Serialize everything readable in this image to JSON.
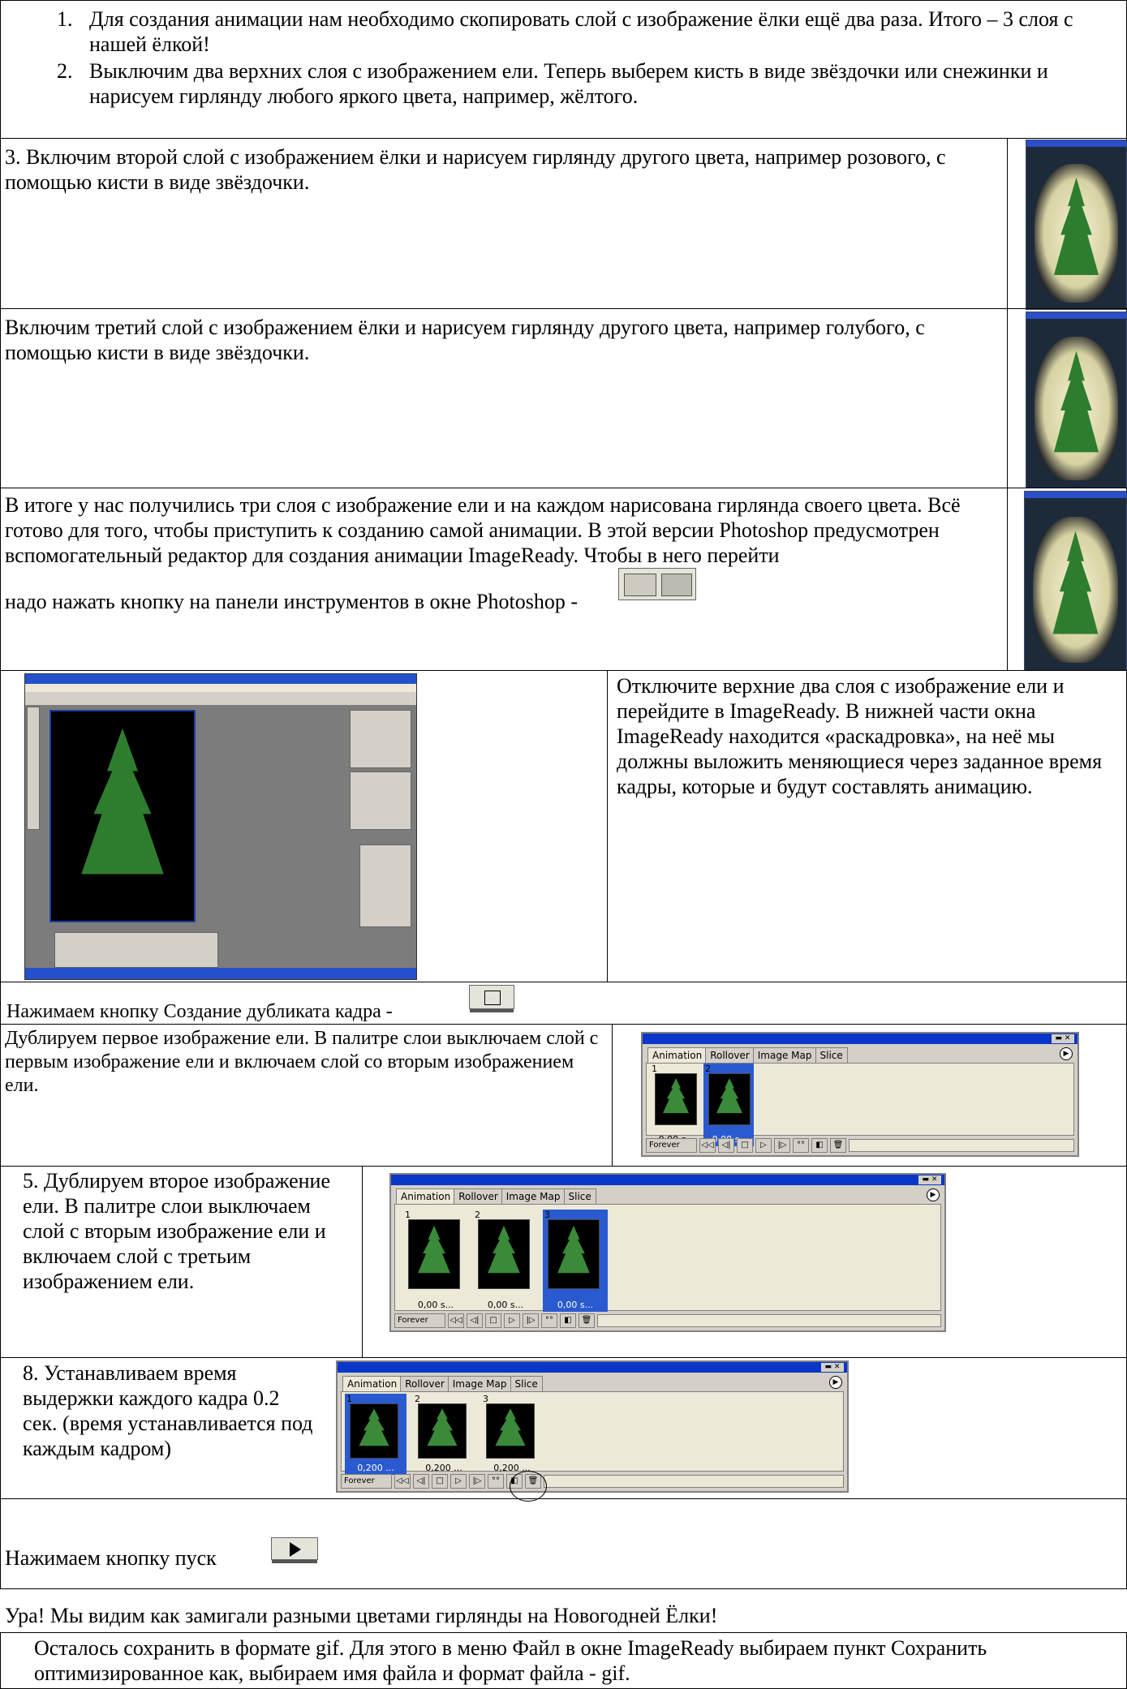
{
  "section1": {
    "items": [
      {
        "num": "1.",
        "text": "Для создания анимации нам необходимо скопировать слой с изображение ёлки ещё два раза. Итого – 3 слоя с нашей ёлкой!"
      },
      {
        "num": "2.",
        "text": "Выключим два верхних слоя с изображением ели. Теперь выберем кисть в виде звёздочки или снежинки и нарисуем гирлянду любого яркого цвета, например, жёлтого."
      }
    ]
  },
  "section2": {
    "text": "3. Включим второй слой с изображением ёлки и нарисуем гирлянду другого цвета, например розового, с помощью кисти в виде звёздочки."
  },
  "section3": {
    "text": "Включим третий слой с изображением ёлки и нарисуем гирлянду другого цвета, например голубого, с помощью кисти в виде звёздочки."
  },
  "section4": {
    "text": "В итоге у нас получились три слоя с изображение ели и на каждом нарисована гирлянда своего цвета. Всё готово для того, чтобы приступить к созданию самой анимации. В этой версии Photoshop предусмотрен вспомогательный редактор для создания анимации ImageReady. Чтобы в него перейти",
    "text2": "надо нажать кнопку на панели инструментов в окне Photoshop -"
  },
  "section5": {
    "text": "Отключите верхние два слоя с изображение ели и перейдите в ImageReady. В нижней части окна ImageReady находится «раскадровка», на неё мы должны выложить меняющиеся через заданное время кадры, которые и будут составлять анимацию."
  },
  "section6": {
    "text": "Нажимаем кнопку Создание дубликата кадра -"
  },
  "section7": {
    "text": "Дублируем первое изображение ели. В палитре слои выключаем слой с первым изображение ели и включаем слой со вторым изображением ели."
  },
  "section8": {
    "text": "5. Дублируем второе изображение ели. В палитре слои выключаем слой с вторым изображение ели и включаем слой с третьим изображением ели."
  },
  "section9": {
    "text": "8. Устанавливаем время выдержки каждого кадра 0.2 сек. (время устанавливается под каждым кадром)"
  },
  "section10": {
    "text": "Нажимаем кнопку пуск",
    "text2": "Ура! Мы видим как замигали разными цветами гирлянды на Новогодней Ёлки!"
  },
  "section11": {
    "text": "Осталось сохранить в формате gif. Для этого в меню Файл в окне ImageReady выбираем пункт Сохранить оптимизированное как, выбираем имя файла и формат файла - gif."
  },
  "palette": {
    "tabs": [
      "Animation",
      "Rollover",
      "Image Map",
      "Slice"
    ],
    "loop": "Forever",
    "p1_times": [
      "0,00 s..",
      "0,00 s.."
    ],
    "p2_times": [
      "0,00 s...",
      "0,00 s...",
      "0,00 s..."
    ],
    "p3_times": [
      "0,200 ...",
      "0,200 ...",
      "0,200 ..."
    ],
    "frame_nums": [
      "1",
      "2",
      "3"
    ]
  }
}
